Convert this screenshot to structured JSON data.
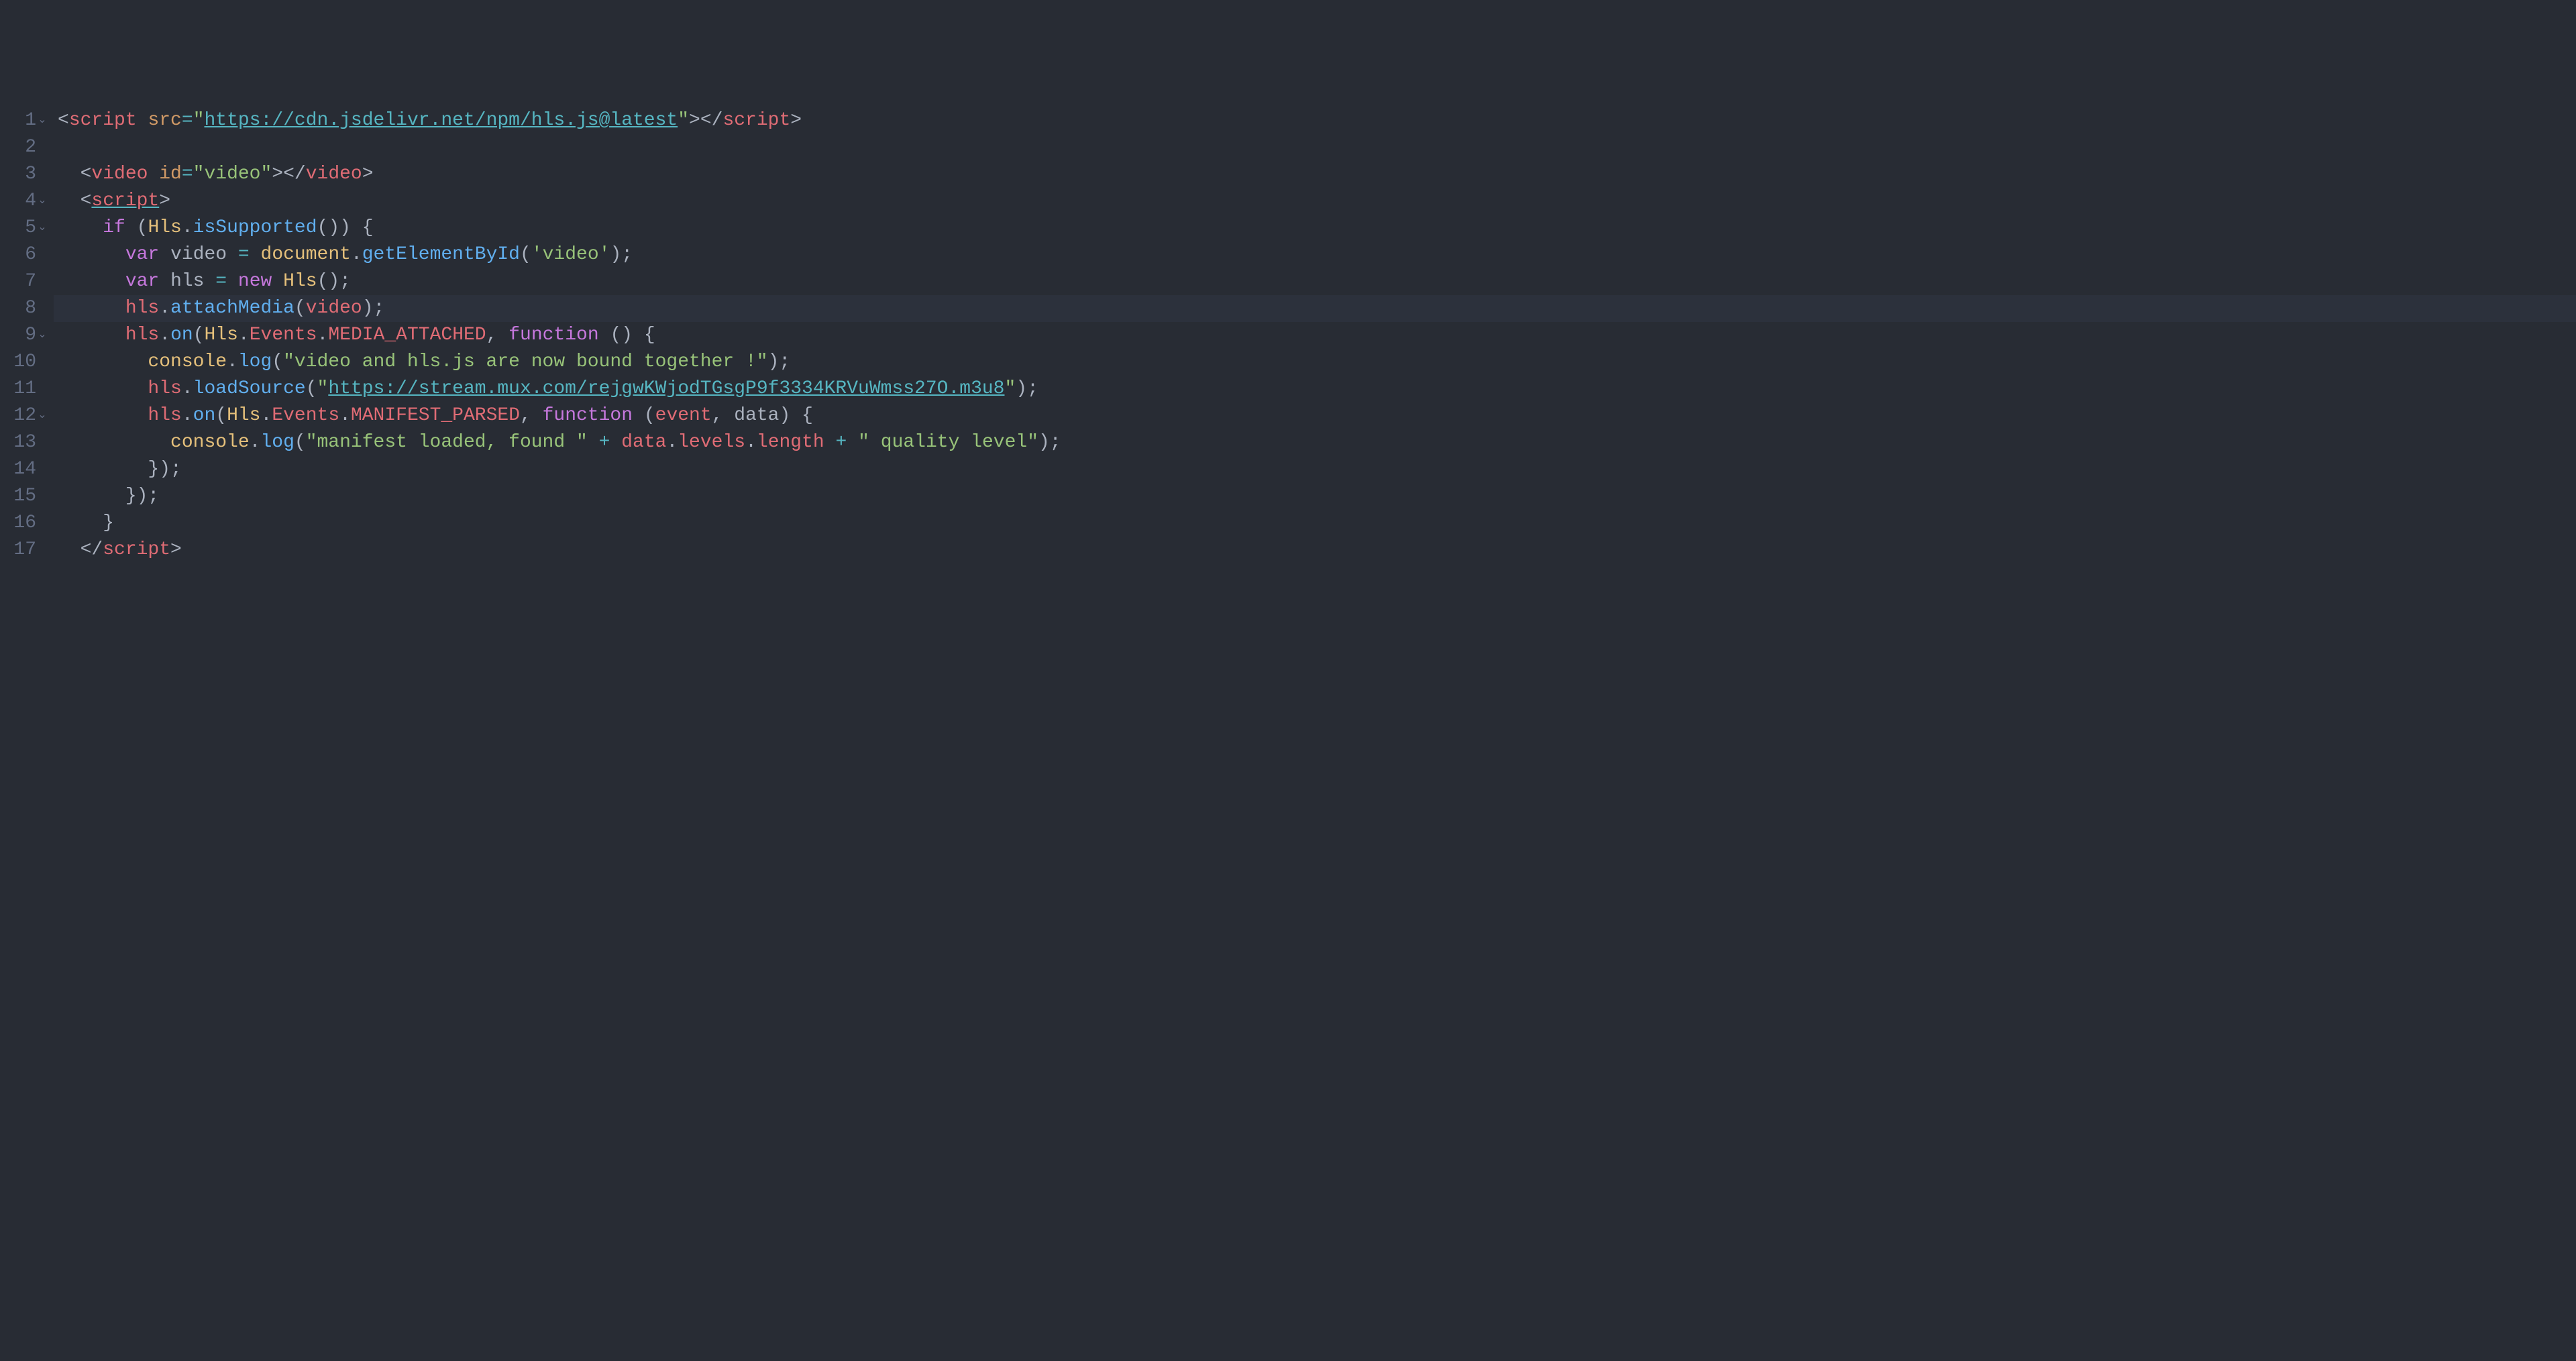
{
  "editor": {
    "lines": [
      {
        "n": "1",
        "fold": "v",
        "active": false,
        "tokens": [
          {
            "c": "p",
            "t": "<"
          },
          {
            "c": "tg",
            "t": "script"
          },
          {
            "c": "p",
            "t": " "
          },
          {
            "c": "at",
            "t": "src"
          },
          {
            "c": "op",
            "t": "="
          },
          {
            "c": "st",
            "t": "\""
          },
          {
            "c": "lk",
            "t": "https://cdn.jsdelivr.net/npm/hls.js@latest"
          },
          {
            "c": "st",
            "t": "\""
          },
          {
            "c": "p",
            "t": ">"
          },
          {
            "c": "p",
            "t": "</"
          },
          {
            "c": "tg",
            "t": "script"
          },
          {
            "c": "p",
            "t": ">"
          }
        ]
      },
      {
        "n": "2",
        "fold": "",
        "active": false,
        "tokens": []
      },
      {
        "n": "3",
        "fold": "",
        "active": false,
        "tokens": [
          {
            "c": "p",
            "t": "  <"
          },
          {
            "c": "tg",
            "t": "video"
          },
          {
            "c": "p",
            "t": " "
          },
          {
            "c": "at",
            "t": "id"
          },
          {
            "c": "op",
            "t": "="
          },
          {
            "c": "st",
            "t": "\"video\""
          },
          {
            "c": "p",
            "t": ">"
          },
          {
            "c": "p",
            "t": "</"
          },
          {
            "c": "tg",
            "t": "video"
          },
          {
            "c": "p",
            "t": ">"
          }
        ]
      },
      {
        "n": "4",
        "fold": "v",
        "active": false,
        "tokens": [
          {
            "c": "p",
            "t": "  <"
          },
          {
            "c": "tg",
            "t": "script"
          },
          {
            "c": "p",
            "t": ">"
          }
        ],
        "underline_tag": true
      },
      {
        "n": "5",
        "fold": "v",
        "active": false,
        "tokens": [
          {
            "c": "p",
            "t": "    "
          },
          {
            "c": "kw",
            "t": "if"
          },
          {
            "c": "p",
            "t": " ("
          },
          {
            "c": "pr",
            "t": "Hls"
          },
          {
            "c": "p",
            "t": "."
          },
          {
            "c": "fn",
            "t": "isSupported"
          },
          {
            "c": "p",
            "t": "()) {"
          }
        ]
      },
      {
        "n": "6",
        "fold": "",
        "active": false,
        "tokens": [
          {
            "c": "p",
            "t": "      "
          },
          {
            "c": "kw",
            "t": "var"
          },
          {
            "c": "p",
            "t": " "
          },
          {
            "c": "vd",
            "t": "video"
          },
          {
            "c": "p",
            "t": " "
          },
          {
            "c": "op",
            "t": "="
          },
          {
            "c": "p",
            "t": " "
          },
          {
            "c": "pr",
            "t": "document"
          },
          {
            "c": "p",
            "t": "."
          },
          {
            "c": "fn",
            "t": "getElementById"
          },
          {
            "c": "p",
            "t": "("
          },
          {
            "c": "st",
            "t": "'video'"
          },
          {
            "c": "p",
            "t": ");"
          }
        ]
      },
      {
        "n": "7",
        "fold": "",
        "active": false,
        "tokens": [
          {
            "c": "p",
            "t": "      "
          },
          {
            "c": "kw",
            "t": "var"
          },
          {
            "c": "p",
            "t": " "
          },
          {
            "c": "vd",
            "t": "hls"
          },
          {
            "c": "p",
            "t": " "
          },
          {
            "c": "op",
            "t": "="
          },
          {
            "c": "p",
            "t": " "
          },
          {
            "c": "kw",
            "t": "new"
          },
          {
            "c": "p",
            "t": " "
          },
          {
            "c": "pr",
            "t": "Hls"
          },
          {
            "c": "p",
            "t": "();"
          }
        ]
      },
      {
        "n": "8",
        "fold": "",
        "active": true,
        "tokens": [
          {
            "c": "p",
            "t": "      "
          },
          {
            "c": "vr",
            "t": "hls"
          },
          {
            "c": "p",
            "t": "."
          },
          {
            "c": "fn",
            "t": "attachMedia"
          },
          {
            "c": "p",
            "t": "("
          },
          {
            "c": "vr",
            "t": "video"
          },
          {
            "c": "p",
            "t": ");"
          }
        ]
      },
      {
        "n": "9",
        "fold": "v",
        "active": false,
        "tokens": [
          {
            "c": "p",
            "t": "      "
          },
          {
            "c": "vr",
            "t": "hls"
          },
          {
            "c": "p",
            "t": "."
          },
          {
            "c": "fn",
            "t": "on"
          },
          {
            "c": "p",
            "t": "("
          },
          {
            "c": "pr",
            "t": "Hls"
          },
          {
            "c": "p",
            "t": "."
          },
          {
            "c": "vr",
            "t": "Events"
          },
          {
            "c": "p",
            "t": "."
          },
          {
            "c": "vr",
            "t": "MEDIA_ATTACHED"
          },
          {
            "c": "p",
            "t": ", "
          },
          {
            "c": "kw",
            "t": "function"
          },
          {
            "c": "p",
            "t": " () {"
          }
        ]
      },
      {
        "n": "10",
        "fold": "",
        "active": false,
        "tokens": [
          {
            "c": "p",
            "t": "        "
          },
          {
            "c": "pr",
            "t": "console"
          },
          {
            "c": "p",
            "t": "."
          },
          {
            "c": "fn",
            "t": "log"
          },
          {
            "c": "p",
            "t": "("
          },
          {
            "c": "st",
            "t": "\"video and hls.js are now bound together !\""
          },
          {
            "c": "p",
            "t": ");"
          }
        ]
      },
      {
        "n": "11",
        "fold": "",
        "active": false,
        "tokens": [
          {
            "c": "p",
            "t": "        "
          },
          {
            "c": "vr",
            "t": "hls"
          },
          {
            "c": "p",
            "t": "."
          },
          {
            "c": "fn",
            "t": "loadSource"
          },
          {
            "c": "p",
            "t": "("
          },
          {
            "c": "st",
            "t": "\""
          },
          {
            "c": "lk",
            "t": "https://stream.mux.com/rejgwKWjodTGsgP9f3334KRVuWmss27O.m3u8"
          },
          {
            "c": "st",
            "t": "\""
          },
          {
            "c": "p",
            "t": ");"
          }
        ]
      },
      {
        "n": "12",
        "fold": "v",
        "active": false,
        "tokens": [
          {
            "c": "p",
            "t": "        "
          },
          {
            "c": "vr",
            "t": "hls"
          },
          {
            "c": "p",
            "t": "."
          },
          {
            "c": "fn",
            "t": "on"
          },
          {
            "c": "p",
            "t": "("
          },
          {
            "c": "pr",
            "t": "Hls"
          },
          {
            "c": "p",
            "t": "."
          },
          {
            "c": "vr",
            "t": "Events"
          },
          {
            "c": "p",
            "t": "."
          },
          {
            "c": "vr",
            "t": "MANIFEST_PARSED"
          },
          {
            "c": "p",
            "t": ", "
          },
          {
            "c": "kw",
            "t": "function"
          },
          {
            "c": "p",
            "t": " ("
          },
          {
            "c": "vr",
            "t": "event"
          },
          {
            "c": "p",
            "t": ", "
          },
          {
            "c": "pa",
            "t": "data"
          },
          {
            "c": "p",
            "t": ") {"
          }
        ]
      },
      {
        "n": "13",
        "fold": "",
        "active": false,
        "tokens": [
          {
            "c": "p",
            "t": "          "
          },
          {
            "c": "pr",
            "t": "console"
          },
          {
            "c": "p",
            "t": "."
          },
          {
            "c": "fn",
            "t": "log"
          },
          {
            "c": "p",
            "t": "("
          },
          {
            "c": "st",
            "t": "\"manifest loaded, found \""
          },
          {
            "c": "p",
            "t": " "
          },
          {
            "c": "op",
            "t": "+"
          },
          {
            "c": "p",
            "t": " "
          },
          {
            "c": "vr",
            "t": "data"
          },
          {
            "c": "p",
            "t": "."
          },
          {
            "c": "vr",
            "t": "levels"
          },
          {
            "c": "p",
            "t": "."
          },
          {
            "c": "vr",
            "t": "length"
          },
          {
            "c": "p",
            "t": " "
          },
          {
            "c": "op",
            "t": "+"
          },
          {
            "c": "p",
            "t": " "
          },
          {
            "c": "st",
            "t": "\" quality level\""
          },
          {
            "c": "p",
            "t": ");"
          }
        ]
      },
      {
        "n": "14",
        "fold": "",
        "active": false,
        "tokens": [
          {
            "c": "p",
            "t": "        });"
          }
        ]
      },
      {
        "n": "15",
        "fold": "",
        "active": false,
        "tokens": [
          {
            "c": "p",
            "t": "      });"
          }
        ]
      },
      {
        "n": "16",
        "fold": "",
        "active": false,
        "tokens": [
          {
            "c": "p",
            "t": "    }"
          }
        ]
      },
      {
        "n": "17",
        "fold": "",
        "active": false,
        "tokens": [
          {
            "c": "p",
            "t": "  </"
          },
          {
            "c": "tg",
            "t": "script"
          },
          {
            "c": "p",
            "t": ">"
          }
        ]
      }
    ]
  }
}
